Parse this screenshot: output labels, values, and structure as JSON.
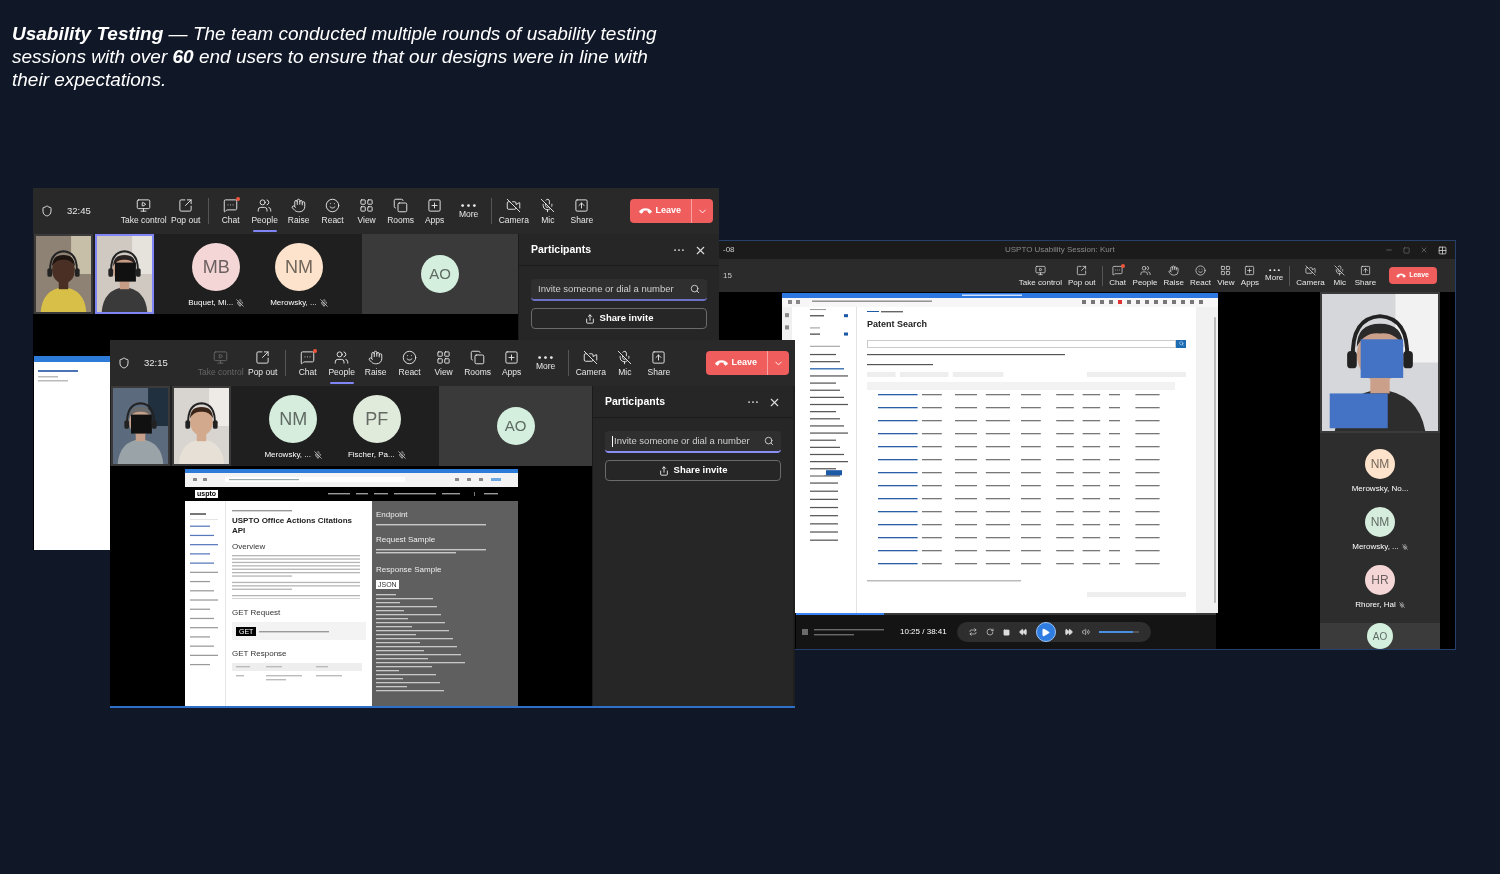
{
  "caption": "**Usability Testing** — The team conducted multiple rounds of usability testing sessions with over **60** end users to ensure that our designs were in line with their expectations.",
  "call_window_1": {
    "timer": "32:45",
    "toolbar": [
      [
        {
          "kind": "take_control",
          "label": "Take control",
          "selected": false,
          "disabled": false,
          "unread": false
        },
        {
          "kind": "pop_out",
          "label": "Pop out",
          "selected": false,
          "disabled": false,
          "unread": false
        }
      ],
      [
        {
          "kind": "chat",
          "label": "Chat",
          "selected": false,
          "disabled": false,
          "unread": true
        },
        {
          "kind": "people",
          "label": "People",
          "selected": true,
          "disabled": false,
          "unread": false
        },
        {
          "kind": "raise",
          "label": "Raise",
          "selected": false,
          "disabled": false,
          "unread": false
        },
        {
          "kind": "react",
          "label": "React",
          "selected": false,
          "disabled": false,
          "unread": false
        },
        {
          "kind": "view",
          "label": "View",
          "selected": false,
          "disabled": false,
          "unread": false
        },
        {
          "kind": "rooms",
          "label": "Rooms",
          "selected": false,
          "disabled": false,
          "unread": false
        },
        {
          "kind": "apps",
          "label": "Apps",
          "selected": false,
          "disabled": false,
          "unread": false
        },
        {
          "kind": "more",
          "label": "More",
          "selected": false,
          "disabled": false,
          "unread": false
        }
      ],
      [
        {
          "kind": "camera",
          "label": "Camera",
          "selected": false,
          "disabled": false,
          "unread": false
        },
        {
          "kind": "mic",
          "label": "Mic",
          "selected": false,
          "disabled": false,
          "unread": false
        },
        {
          "kind": "share",
          "label": "Share",
          "selected": false,
          "disabled": false,
          "unread": false
        }
      ]
    ],
    "leave": {
      "label": "Leave",
      "dropdown": true
    },
    "tiles": [
      {
        "kind": "video",
        "selected": false
      },
      {
        "kind": "video",
        "selected": true
      },
      {
        "kind": "avatar",
        "initials": "MB",
        "name": "Buquet, Mi...",
        "muted": true,
        "color": "#f4d6d6"
      },
      {
        "kind": "avatar",
        "initials": "NM",
        "name": "Merowsky, ...",
        "muted": true,
        "color": "#fde3cb"
      }
    ],
    "spotlight": {
      "initials": "AO",
      "color": "#d4efde"
    },
    "panel": {
      "title": "Participants",
      "invite_placeholder": "Invite someone or dial a number",
      "invite_focused": false,
      "share_label": "Share invite"
    }
  },
  "call_window_2": {
    "timer": "32:15",
    "toolbar": [
      [
        {
          "kind": "take_control",
          "label": "Take control",
          "selected": false,
          "disabled": true,
          "unread": false
        },
        {
          "kind": "pop_out",
          "label": "Pop out",
          "selected": false,
          "disabled": false,
          "unread": false
        }
      ],
      [
        {
          "kind": "chat",
          "label": "Chat",
          "selected": false,
          "disabled": false,
          "unread": true
        },
        {
          "kind": "people",
          "label": "People",
          "selected": true,
          "disabled": false,
          "unread": false
        },
        {
          "kind": "raise",
          "label": "Raise",
          "selected": false,
          "disabled": false,
          "unread": false
        },
        {
          "kind": "react",
          "label": "React",
          "selected": false,
          "disabled": false,
          "unread": false
        },
        {
          "kind": "view",
          "label": "View",
          "selected": false,
          "disabled": false,
          "unread": false
        },
        {
          "kind": "rooms",
          "label": "Rooms",
          "selected": false,
          "disabled": false,
          "unread": false
        },
        {
          "kind": "apps",
          "label": "Apps",
          "selected": false,
          "disabled": false,
          "unread": false
        },
        {
          "kind": "more",
          "label": "More",
          "selected": false,
          "disabled": false,
          "unread": false
        }
      ],
      [
        {
          "kind": "camera",
          "label": "Camera",
          "selected": false,
          "disabled": false,
          "unread": false
        },
        {
          "kind": "mic",
          "label": "Mic",
          "selected": false,
          "disabled": false,
          "unread": false
        },
        {
          "kind": "share",
          "label": "Share",
          "selected": false,
          "disabled": false,
          "unread": false
        }
      ]
    ],
    "leave": {
      "label": "Leave",
      "dropdown": true
    },
    "tiles": [
      {
        "kind": "video",
        "selected": false
      },
      {
        "kind": "video",
        "selected": false
      },
      {
        "kind": "avatar",
        "initials": "NM",
        "name": "Merowsky, ...",
        "muted": true,
        "color": "#d6eddd"
      },
      {
        "kind": "avatar",
        "initials": "PF",
        "name": "Fischer, Pa...",
        "muted": true,
        "color": "#e1ebdc"
      }
    ],
    "spotlight": {
      "initials": "AO",
      "color": "#d4efde"
    },
    "panel": {
      "title": "Participants",
      "invite_placeholder": "Invite someone or dial a number",
      "invite_focused": true,
      "share_label": "Share invite"
    },
    "shared_page": {
      "logo": "uspto",
      "heading": "USPTO Office Actions Citations API",
      "overview": "Overview",
      "get_request": "GET Request",
      "method": "GET",
      "get_response": "GET Response",
      "side_headings": [
        "Endpoint",
        "Request Sample",
        "Response Sample"
      ],
      "format_tab": "JSON"
    }
  },
  "call_window_3": {
    "title": "USPTO Usability Session: Kurt",
    "title_fragment": "-08",
    "toolbar_fragment": "15",
    "toolbar": [
      [
        {
          "kind": "take_control",
          "label": "Take control",
          "selected": false,
          "disabled": false,
          "unread": false
        },
        {
          "kind": "pop_out",
          "label": "Pop out",
          "selected": false,
          "disabled": false,
          "unread": false
        }
      ],
      [
        {
          "kind": "chat",
          "label": "Chat",
          "selected": false,
          "disabled": false,
          "unread": true
        },
        {
          "kind": "people",
          "label": "People",
          "selected": false,
          "disabled": false,
          "unread": false
        },
        {
          "kind": "raise",
          "label": "Raise",
          "selected": false,
          "disabled": false,
          "unread": false
        },
        {
          "kind": "react",
          "label": "React",
          "selected": false,
          "disabled": false,
          "unread": false
        },
        {
          "kind": "view",
          "label": "View",
          "selected": false,
          "disabled": false,
          "unread": false
        },
        {
          "kind": "apps",
          "label": "Apps",
          "selected": false,
          "disabled": false,
          "unread": false
        },
        {
          "kind": "more",
          "label": "More",
          "selected": false,
          "disabled": false,
          "unread": false
        }
      ],
      [
        {
          "kind": "camera",
          "label": "Camera",
          "selected": false,
          "disabled": false,
          "unread": false
        },
        {
          "kind": "mic",
          "label": "Mic",
          "selected": false,
          "disabled": false,
          "unread": false
        },
        {
          "kind": "share",
          "label": "Share",
          "selected": false,
          "disabled": false,
          "unread": false
        }
      ]
    ],
    "leave": {
      "label": "Leave",
      "dropdown": false
    },
    "shared_page": {
      "heading": "Patent Search"
    },
    "player": {
      "time": "10:25 / 38:41",
      "progress": {
        "level": 0.21
      },
      "volume": {
        "level": 0.85
      }
    },
    "rail_tiles": [
      {
        "kind": "video",
        "selected": false
      },
      {
        "kind": "avatar",
        "initials": "NM",
        "name": "Merowsky, No...",
        "muted": false,
        "color": "#fde3cb"
      },
      {
        "kind": "avatar",
        "initials": "NM",
        "name": "Merowsky, ...",
        "muted": true,
        "color": "#d6eddd"
      },
      {
        "kind": "avatar",
        "initials": "HR",
        "name": "Rhorer, Hal",
        "muted": true,
        "color": "#f4d6d6"
      }
    ],
    "spotlight": {
      "initials": "AO",
      "color": "#d4efde"
    }
  }
}
